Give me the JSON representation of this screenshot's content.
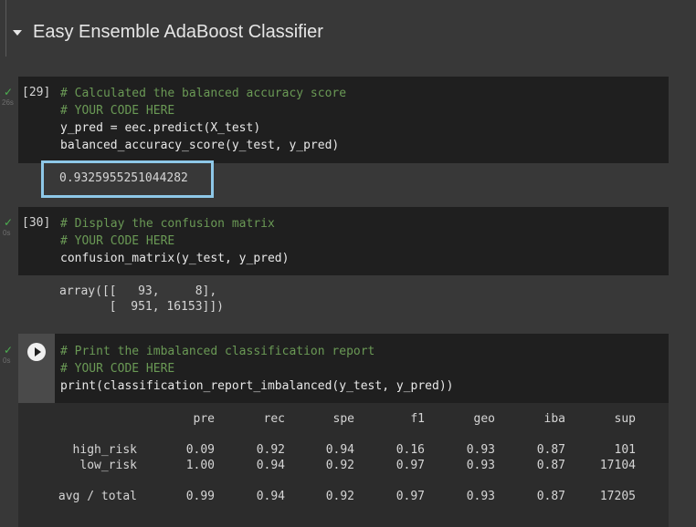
{
  "section": {
    "title": "Easy Ensemble AdaBoost Classifier"
  },
  "cells": [
    {
      "exec": "[29]",
      "status": "✓",
      "time": "26s",
      "lines": [
        {
          "text": "# Calculated the balanced accuracy score",
          "kind": "comment"
        },
        {
          "text": "# YOUR CODE HERE",
          "kind": "comment"
        },
        {
          "text": "y_pred = eec.predict(X_test)",
          "kind": "code"
        },
        {
          "text": "balanced_accuracy_score(y_test, y_pred)",
          "kind": "code"
        }
      ],
      "output": "0.9325955251044282"
    },
    {
      "exec": "[30]",
      "status": "✓",
      "time": "0s",
      "lines": [
        {
          "text": "# Display the confusion matrix",
          "kind": "comment"
        },
        {
          "text": "# YOUR CODE HERE",
          "kind": "comment"
        },
        {
          "text": "confusion_matrix(y_test, y_pred)",
          "kind": "code"
        }
      ],
      "output_lines": [
        "array([[   93,     8],",
        "       [  951, 16153]])"
      ]
    },
    {
      "status": "✓",
      "time": "0s",
      "lines": [
        {
          "text": "# Print the imbalanced classification report",
          "kind": "comment"
        },
        {
          "text": "# YOUR CODE HERE",
          "kind": "comment"
        },
        {
          "text": "print(classification_report_imbalanced(y_test, y_pred))",
          "kind": "code"
        }
      ]
    }
  ],
  "report": {
    "headers": [
      "pre",
      "rec",
      "spe",
      "f1",
      "geo",
      "iba",
      "sup"
    ],
    "rows": [
      {
        "label": "high_risk",
        "values": [
          "0.09",
          "0.92",
          "0.94",
          "0.16",
          "0.93",
          "0.87",
          "101"
        ]
      },
      {
        "label": "low_risk",
        "values": [
          "1.00",
          "0.94",
          "0.92",
          "0.97",
          "0.93",
          "0.87",
          "17104"
        ]
      },
      {
        "label": "avg / total",
        "values": [
          "0.99",
          "0.94",
          "0.92",
          "0.97",
          "0.93",
          "0.87",
          "17205"
        ]
      }
    ]
  },
  "icons": {
    "collapse": "caret-down-icon",
    "run": "play-circle-icon",
    "status": "check-icon"
  },
  "colors": {
    "comment": "#6a9955",
    "highlight": "#8ec8e8",
    "check": "#4caf50"
  }
}
